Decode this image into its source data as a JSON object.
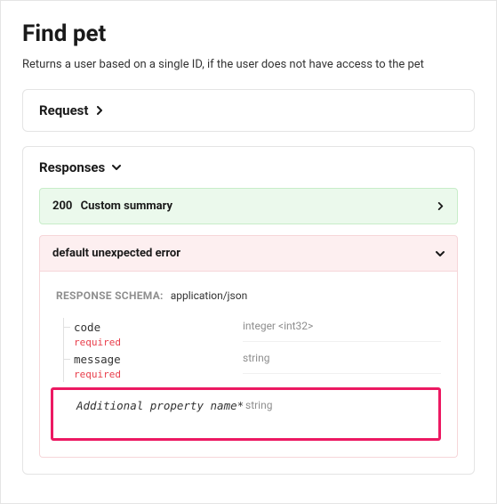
{
  "page": {
    "title": "Find pet",
    "description": "Returns a user based on a single ID, if the user does not have access to the pet"
  },
  "request": {
    "label": "Request"
  },
  "responses": {
    "label": "Responses",
    "success": {
      "code": "200",
      "summary": "Custom summary"
    },
    "error": {
      "label": "default unexpected error",
      "schema_label": "RESPONSE SCHEMA: ",
      "mime": "application/json",
      "fields": {
        "code": {
          "name": "code",
          "required": "required",
          "type": "integer <int32>"
        },
        "message": {
          "name": "message",
          "required": "required",
          "type": "string"
        },
        "additional": {
          "name": "Additional property name*",
          "type": "string"
        }
      }
    }
  }
}
